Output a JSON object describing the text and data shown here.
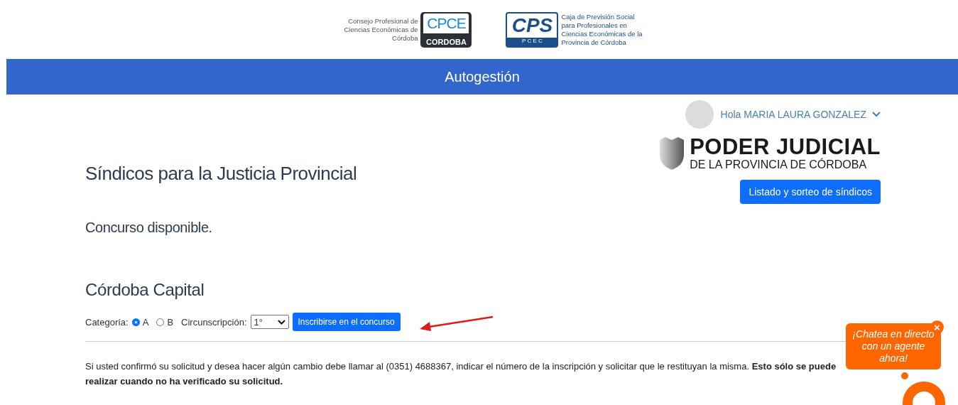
{
  "logos": {
    "cpce_text": [
      "Consejo Profesional de",
      "Ciencias Económicas de",
      "Córdoba"
    ],
    "cpce_mark": "CPCE",
    "cpce_band": "CORDOBA",
    "cps_mark": "CPS",
    "cps_band": "P C E C",
    "cps_text": [
      "Caja de Previsión Social",
      "para Profesionales en",
      "Ciencias Económicas de la",
      "Provincia de Córdoba"
    ]
  },
  "banner": {
    "title": "Autogestión"
  },
  "user": {
    "greeting": "Hola MARIA LAURA GONZALEZ"
  },
  "page": {
    "title": "Síndicos para la Justicia Provincial",
    "judicial_title": "PODER JUDICIAL",
    "judicial_subtitle": "DE LA PROVINCIA DE CÓRDOBA",
    "list_button": "Listado y sorteo de síndicos",
    "status": "Concurso disponible."
  },
  "contest": {
    "region": "Córdoba Capital",
    "category_label": "Categoría:",
    "categories": [
      {
        "label": "A",
        "selected": true
      },
      {
        "label": "B",
        "selected": false
      }
    ],
    "district_label": "Circunscripción:",
    "district_value": "1°",
    "submit": "Inscribirse en el concurso"
  },
  "notice": "Si usted confirmó su solicitud y desea hacer algún cambio debe llamar al (0351) 4688367, indicar el número de la inscripción y solicitar que le restituyan la misma. **Esto sólo se puede realizar cuando no ha verificado su solicitud.**",
  "chat": {
    "bubble": "¡Chatea en directo con un agente ahora!",
    "close": "×"
  }
}
